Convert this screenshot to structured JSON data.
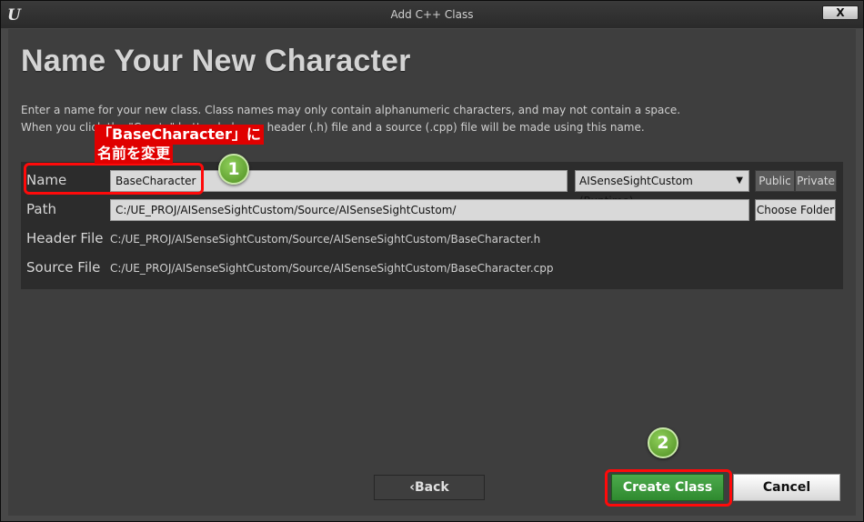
{
  "window": {
    "title": "Add C++ Class",
    "close_label": "X",
    "logo": "U"
  },
  "heading": "Name Your New Character",
  "description": {
    "line1": "Enter a name for your new class. Class names may only contain alphanumeric characters, and may not contain a space.",
    "line2": "When you click the \"Create\" button below, a header (.h) file and a source (.cpp) file will be made using this name."
  },
  "form": {
    "name_label": "Name",
    "name_value": "BaseCharacter",
    "module_dropdown": "AISenseSightCustom (Runtime)",
    "public_label": "Public",
    "private_label": "Private",
    "path_label": "Path",
    "path_value": "C:/UE_PROJ/AISenseSightCustom/Source/AISenseSightCustom/",
    "choose_folder_label": "Choose Folder",
    "header_label": "Header File",
    "header_value": "C:/UE_PROJ/AISenseSightCustom/Source/AISenseSightCustom/BaseCharacter.h",
    "source_label": "Source File",
    "source_value": "C:/UE_PROJ/AISenseSightCustom/Source/AISenseSightCustom/BaseCharacter.cpp"
  },
  "buttons": {
    "back": "Back",
    "create": "Create Class",
    "cancel": "Cancel"
  },
  "annotations": {
    "note_line1": "「BaseCharacter」に",
    "note_line2": "名前を変更",
    "step1": "1",
    "step2": "2"
  },
  "colors": {
    "accent_green": "#3a9a3a",
    "annotation_red": "#ff0a0a"
  }
}
